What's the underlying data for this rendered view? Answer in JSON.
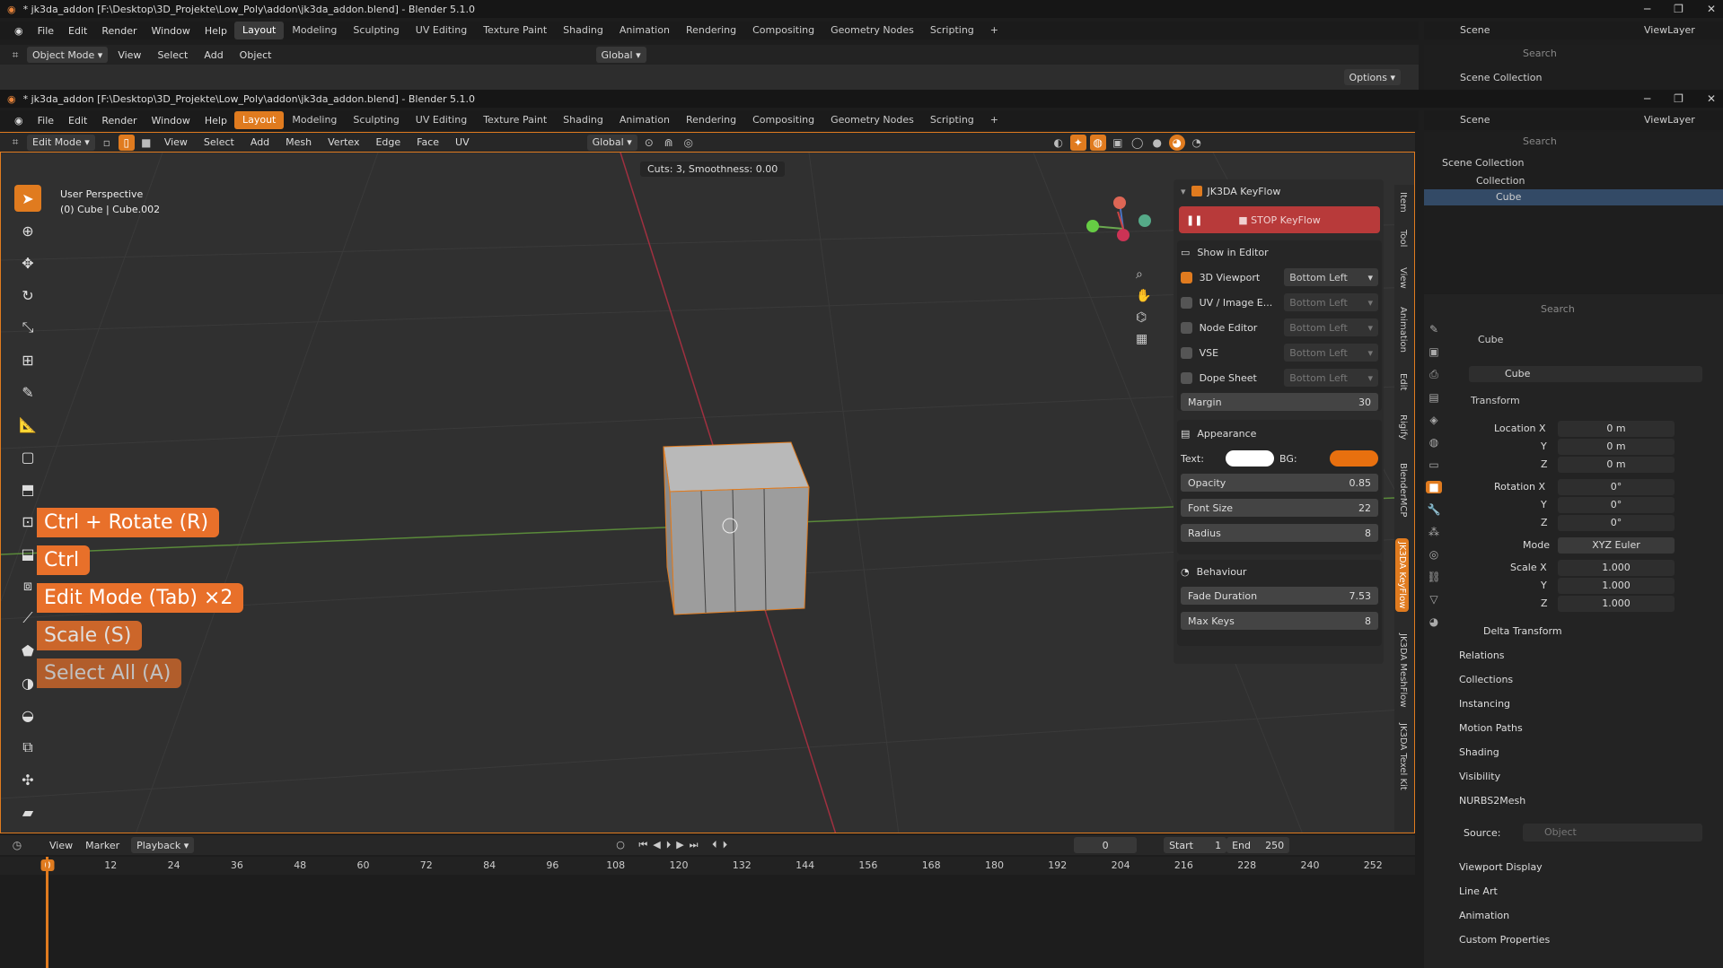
{
  "window_back": {
    "title": "* jk3da_addon [F:\\Desktop\\3D_Projekte\\Low_Poly\\addon\\jk3da_addon.blend] - Blender 5.1.0"
  },
  "window_front": {
    "title": "* jk3da_addon [F:\\Desktop\\3D_Projekte\\Low_Poly\\addon\\jk3da_addon.blend] - Blender 5.1.0"
  },
  "menu": {
    "items": [
      "File",
      "Edit",
      "Render",
      "Window",
      "Help"
    ]
  },
  "workspaces": [
    "Layout",
    "Modeling",
    "Sculpting",
    "UV Editing",
    "Texture Paint",
    "Shading",
    "Animation",
    "Rendering",
    "Compositing",
    "Geometry Nodes",
    "Scripting"
  ],
  "top_right": {
    "scene": "Scene",
    "viewlayer": "ViewLayer",
    "search_placeholder": "Search",
    "scene_collection": "Scene Collection",
    "options": "Options"
  },
  "back_header": {
    "mode": "Object Mode",
    "view": "View",
    "select": "Select",
    "add": "Add",
    "object": "Object",
    "transform": "Global"
  },
  "edit_header": {
    "mode": "Edit Mode",
    "view": "View",
    "select": "Select",
    "add": "Add",
    "mesh": "Mesh",
    "vertex": "Vertex",
    "edge": "Edge",
    "face": "Face",
    "uv": "UV",
    "transform": "Global"
  },
  "viewport": {
    "perspective": "User Perspective",
    "object_info": "(0) Cube | Cube.002",
    "operator_info": "Cuts: 3, Smoothness: 0.00"
  },
  "key_badges": [
    "Ctrl + Rotate (R)",
    "Ctrl",
    "Edit Mode (Tab)  ×2",
    "Scale (S)",
    "Select All (A)"
  ],
  "keyflow": {
    "title": "JK3DA KeyFlow",
    "stop_button": "STOP KeyFlow",
    "show_in_editor": "Show in Editor",
    "editors": [
      {
        "label": "3D Viewport",
        "position": "Bottom Left",
        "checked": true
      },
      {
        "label": "UV / Image E...",
        "position": "Bottom Left",
        "checked": false
      },
      {
        "label": "Node Editor",
        "position": "Bottom Left",
        "checked": false
      },
      {
        "label": "VSE",
        "position": "Bottom Left",
        "checked": false
      },
      {
        "label": "Dope Sheet",
        "position": "Bottom Left",
        "checked": false
      }
    ],
    "margin_label": "Margin",
    "margin_value": "30",
    "appearance": "Appearance",
    "text_label": "Text:",
    "bg_label": "BG:",
    "text_color": "#ffffff",
    "bg_color": "#e8700f",
    "opacity_label": "Opacity",
    "opacity_value": "0.85",
    "font_size_label": "Font Size",
    "font_size_value": "22",
    "radius_label": "Radius",
    "radius_value": "8",
    "behaviour": "Behaviour",
    "fade_label": "Fade Duration",
    "fade_value": "7.53",
    "maxkeys_label": "Max Keys",
    "maxkeys_value": "8"
  },
  "side_tabs": [
    "Item",
    "Tool",
    "View",
    "Animation",
    "Edit",
    "Rigify",
    "BlenderMCP",
    "JK3DA KeyFlow",
    "JK3DA MeshFlow",
    "JK3DA Texel Kit"
  ],
  "outliner": {
    "scene_collection": "Scene Collection",
    "collection": "Collection",
    "cube": "Cube"
  },
  "properties": {
    "search_placeholder": "Search",
    "object_name": "Cube",
    "data_name": "Cube",
    "transform": "Transform",
    "location_label": "Location X",
    "loc": [
      "0 m",
      "0 m",
      "0 m"
    ],
    "rotation_label": "Rotation X",
    "rot": [
      "0°",
      "0°",
      "0°"
    ],
    "mode_label": "Mode",
    "mode_value": "XYZ Euler",
    "scale_label": "Scale X",
    "scale": [
      "1.000",
      "1.000",
      "1.000"
    ],
    "y": "Y",
    "z": "Z",
    "delta": "Delta Transform",
    "sections": [
      "Relations",
      "Collections",
      "Instancing",
      "Motion Paths",
      "Shading",
      "Visibility"
    ],
    "nurbs": "NURBS2Mesh",
    "source_label": "Source:",
    "source_placeholder": "Object",
    "sections2": [
      "Viewport Display",
      "Line Art",
      "Animation",
      "Custom Properties"
    ]
  },
  "timeline": {
    "view": "View",
    "marker": "Marker",
    "playback": "Playback",
    "current": "0",
    "start_label": "Start",
    "start": "1",
    "end_label": "End",
    "end": "250",
    "ticks": [
      "0",
      "12",
      "24",
      "36",
      "48",
      "60",
      "72",
      "84",
      "96",
      "108",
      "120",
      "132",
      "144",
      "156",
      "168",
      "180",
      "192",
      "204",
      "216",
      "228",
      "240",
      "252"
    ]
  },
  "colors": {
    "accent": "#e07b1f",
    "badge": "#e8702a",
    "stop": "#b83a3a"
  }
}
